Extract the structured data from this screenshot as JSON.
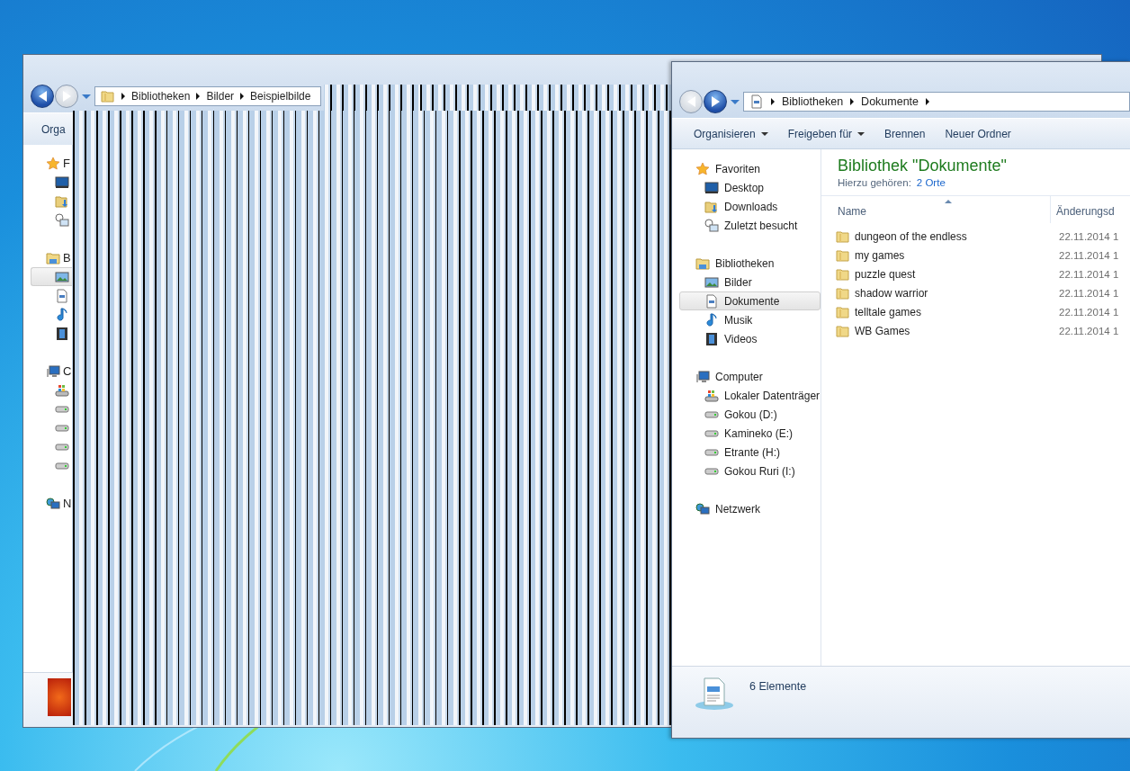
{
  "back_window": {
    "nav": {
      "back_enabled": true,
      "forward_enabled": false
    },
    "address": [
      "Bibliotheken",
      "Bilder",
      "Beispielbilde"
    ],
    "toolbar": [
      "Orga"
    ],
    "sidebar": [
      {
        "label": "F",
        "kind": "star",
        "items": [
          {
            "kind": "desktop",
            "selected": false
          },
          {
            "kind": "downloads",
            "selected": false
          },
          {
            "kind": "recent",
            "selected": false
          }
        ]
      },
      {
        "label": "B",
        "kind": "library",
        "items": [
          {
            "kind": "pictures",
            "selected": true
          },
          {
            "kind": "documents",
            "selected": false
          },
          {
            "kind": "music",
            "selected": false
          },
          {
            "kind": "videos",
            "selected": false
          }
        ]
      },
      {
        "label": "C",
        "kind": "computer",
        "items": [
          {
            "kind": "system-drive",
            "selected": false
          },
          {
            "kind": "drive",
            "selected": false
          },
          {
            "kind": "drive",
            "selected": false
          },
          {
            "kind": "drive",
            "selected": false
          },
          {
            "kind": "drive",
            "selected": false
          }
        ]
      },
      {
        "label": "N",
        "kind": "network"
      }
    ]
  },
  "front_window": {
    "nav": {
      "back_enabled": false,
      "forward_enabled": true
    },
    "address": [
      "Bibliotheken",
      "Dokumente"
    ],
    "toolbar": [
      {
        "label": "Organisieren",
        "dropdown": true
      },
      {
        "label": "Freigeben für",
        "dropdown": true
      },
      {
        "label": "Brennen",
        "dropdown": false
      },
      {
        "label": "Neuer Ordner",
        "dropdown": false
      }
    ],
    "sidebar": [
      {
        "label": "Favoriten",
        "kind": "star",
        "items": [
          {
            "label": "Desktop",
            "kind": "desktop",
            "selected": false
          },
          {
            "label": "Downloads",
            "kind": "downloads",
            "selected": false
          },
          {
            "label": "Zuletzt besucht",
            "kind": "recent",
            "selected": false
          }
        ]
      },
      {
        "label": "Bibliotheken",
        "kind": "library",
        "items": [
          {
            "label": "Bilder",
            "kind": "pictures",
            "selected": false
          },
          {
            "label": "Dokumente",
            "kind": "documents",
            "selected": true
          },
          {
            "label": "Musik",
            "kind": "music",
            "selected": false
          },
          {
            "label": "Videos",
            "kind": "videos",
            "selected": false
          }
        ]
      },
      {
        "label": "Computer",
        "kind": "computer",
        "items": [
          {
            "label": "Lokaler Datenträger",
            "kind": "system-drive",
            "selected": false
          },
          {
            "label": "Gokou (D:)",
            "kind": "drive",
            "selected": false
          },
          {
            "label": "Kamineko (E:)",
            "kind": "drive",
            "selected": false
          },
          {
            "label": "Etrante (H:)",
            "kind": "drive",
            "selected": false
          },
          {
            "label": "Gokou Ruri (I:)",
            "kind": "drive",
            "selected": false
          }
        ]
      },
      {
        "label": "Netzwerk",
        "kind": "network"
      }
    ],
    "library": {
      "title": "Bibliothek \"Dokumente\"",
      "subtitle": "Hierzu gehören:",
      "link": "2 Orte"
    },
    "columns": [
      "Name",
      "Änderungsd"
    ],
    "files": [
      {
        "name": "dungeon of the endless",
        "modified": "22.11.2014 1"
      },
      {
        "name": "my games",
        "modified": "22.11.2014 1"
      },
      {
        "name": "puzzle quest",
        "modified": "22.11.2014 1"
      },
      {
        "name": "shadow warrior",
        "modified": "22.11.2014 1"
      },
      {
        "name": "telltale games",
        "modified": "22.11.2014 1"
      },
      {
        "name": "WB Games",
        "modified": "22.11.2014 1"
      }
    ],
    "status": "6 Elemente"
  }
}
